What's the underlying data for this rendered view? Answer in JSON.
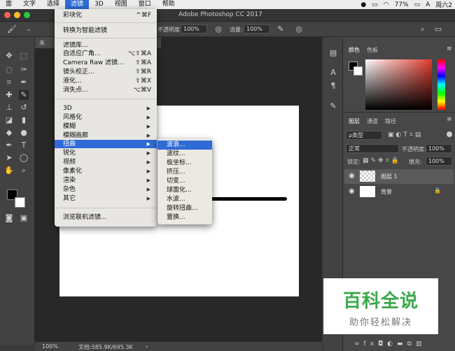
{
  "menubar": {
    "items": [
      "面",
      "文字",
      "选择",
      "滤镜",
      "3D",
      "视图",
      "窗口",
      "帮助"
    ],
    "active_index": 3,
    "battery": "77%",
    "clock": "周六2"
  },
  "window": {
    "title": "Adobe Photoshop CC 2017"
  },
  "options": {
    "opacity_label": "不透明度:",
    "opacity_value": "100%",
    "flow_label": "流量:",
    "flow_value": "100%"
  },
  "document": {
    "tab_label": "未",
    "zoom": "100%",
    "doc_info": "文档:585.9K/695.3K"
  },
  "filter_menu": {
    "items": [
      {
        "label": "彩块化",
        "shortcut": "^⌘F"
      },
      {
        "label": "转换为智能滤镜",
        "shortcut": ""
      },
      {
        "label": "滤镜库...",
        "shortcut": ""
      },
      {
        "label": "自适应广角...",
        "shortcut": "⌥⇧⌘A"
      },
      {
        "label": "Camera Raw 滤镜...",
        "shortcut": "⇧⌘A"
      },
      {
        "label": "镜头校正...",
        "shortcut": "⇧⌘R"
      },
      {
        "label": "液化...",
        "shortcut": "⇧⌘X"
      },
      {
        "label": "消失点...",
        "shortcut": "⌥⌘V"
      },
      {
        "label": "3D"
      },
      {
        "label": "风格化"
      },
      {
        "label": "模糊"
      },
      {
        "label": "模糊画廊"
      },
      {
        "label": "扭曲"
      },
      {
        "label": "锐化"
      },
      {
        "label": "视频"
      },
      {
        "label": "像素化"
      },
      {
        "label": "渲染"
      },
      {
        "label": "杂色"
      },
      {
        "label": "其它"
      },
      {
        "label": "浏览联机滤镜..."
      }
    ],
    "highlighted": "扭曲"
  },
  "distort_menu": {
    "items": [
      "波浪...",
      "波纹...",
      "极坐标...",
      "挤压...",
      "切变...",
      "球面化...",
      "水波...",
      "旋转扭曲...",
      "置换..."
    ],
    "highlighted": "波浪..."
  },
  "panels": {
    "color_tabs": [
      "颜色",
      "色板"
    ],
    "layer_tabs": [
      "图层",
      "通道",
      "路径"
    ],
    "kind_filter": "ρ类型",
    "blend_mode": "正常",
    "opacity_label": "不透明度:",
    "opacity_value": "100%",
    "lock_label": "锁定:",
    "fill_label": "填充:",
    "fill_value": "100%",
    "layers": [
      {
        "name": "图层 1",
        "selected": true
      },
      {
        "name": "背景",
        "selected": false,
        "locked": true
      }
    ]
  },
  "watermark": {
    "title": "百科全说",
    "subtitle": "助你轻松解决"
  },
  "colors": {
    "accent": "#2f6bd6",
    "panel_bg": "#474747",
    "canvas": "#ffffff"
  }
}
